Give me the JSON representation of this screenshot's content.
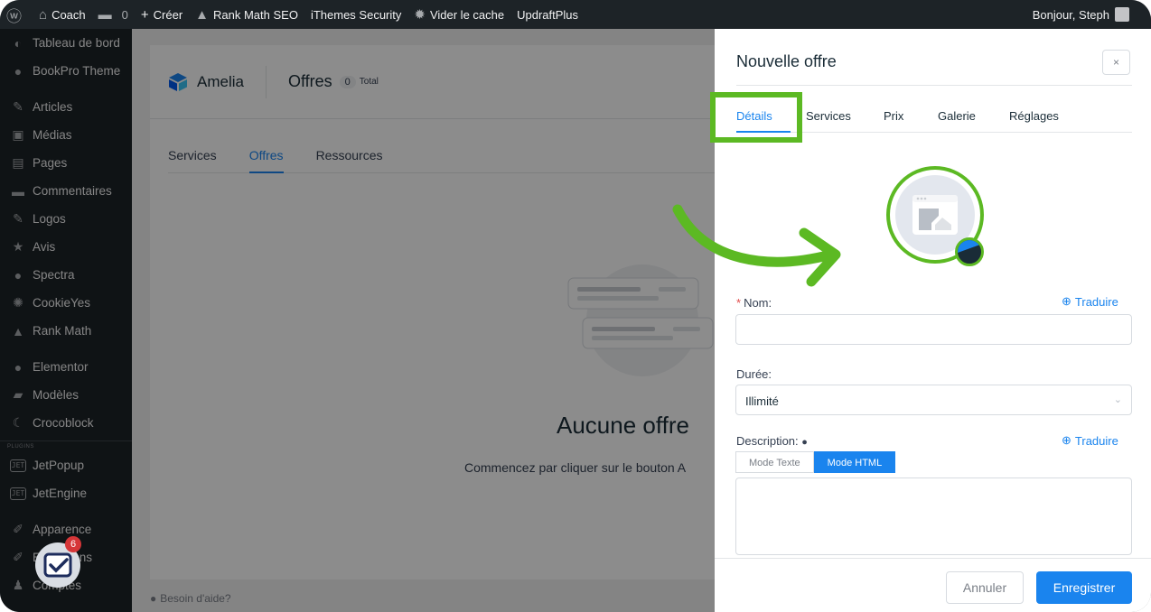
{
  "admin_bar": {
    "site_name": "Coach",
    "comments_count": "0",
    "create": "Créer",
    "rank_math": "Rank Math SEO",
    "security": "iThemes Security",
    "cache": "Vider le cache",
    "updraft": "UpdraftPlus",
    "greeting": "Bonjour, Steph"
  },
  "sidebar": {
    "items": [
      {
        "label": "Tableau de bord",
        "icon": "dashboard-icon",
        "glyph": "◐"
      },
      {
        "label": "BookPro Theme",
        "icon": "bookpro-icon",
        "glyph": "●"
      },
      {
        "label": "Articles",
        "icon": "pin-icon",
        "glyph": "✎"
      },
      {
        "label": "Médias",
        "icon": "media-icon",
        "glyph": "▣"
      },
      {
        "label": "Pages",
        "icon": "pages-icon",
        "glyph": "▤"
      },
      {
        "label": "Commentaires",
        "icon": "comment-icon",
        "glyph": "▬"
      },
      {
        "label": "Logos",
        "icon": "pin-icon",
        "glyph": "✎"
      },
      {
        "label": "Avis",
        "icon": "star-icon",
        "glyph": "★"
      },
      {
        "label": "Spectra",
        "icon": "spectra-icon",
        "glyph": "●"
      },
      {
        "label": "CookieYes",
        "icon": "cookie-icon",
        "glyph": "✺"
      },
      {
        "label": "Rank Math",
        "icon": "rankmath-icon",
        "glyph": "▲"
      },
      {
        "label": "Elementor",
        "icon": "elementor-icon",
        "glyph": "●"
      },
      {
        "label": "Modèles",
        "icon": "folder-icon",
        "glyph": "▰"
      },
      {
        "label": "Crocoblock",
        "icon": "crocoblock-icon",
        "glyph": "☾"
      },
      {
        "label": "JetPopup",
        "icon": "jet-icon",
        "glyph": "JET"
      },
      {
        "label": "JetEngine",
        "icon": "jet-icon",
        "glyph": "JET"
      },
      {
        "label": "Apparence",
        "icon": "brush-icon",
        "glyph": "✐"
      },
      {
        "label": "Extensions",
        "icon": "plugin-icon",
        "glyph": "✐"
      },
      {
        "label": "Comptes",
        "icon": "user-icon",
        "glyph": "♟"
      }
    ],
    "section_label": "PLUGINS"
  },
  "amelia": {
    "brand": "Amelia",
    "page_title": "Offres",
    "count": "0",
    "total_label": "Total",
    "tabs": [
      "Services",
      "Offres",
      "Ressources"
    ],
    "active_tab": "Offres",
    "empty_title": "Aucune offre",
    "empty_sub": "Commencez par cliquer sur le bouton A",
    "help": "Besoin d'aide?"
  },
  "drawer": {
    "title": "Nouvelle offre",
    "close": "×",
    "tabs": [
      "Détails",
      "Services",
      "Prix",
      "Galerie",
      "Réglages"
    ],
    "active_tab": "Détails",
    "name_label": "Nom:",
    "translate": "Traduire",
    "duration_label": "Durée:",
    "duration_value": "Illimité",
    "description_label": "Description:",
    "mode_text": "Mode Texte",
    "mode_html": "Mode HTML",
    "cancel": "Annuler",
    "save": "Enregistrer"
  },
  "notification_count": "6",
  "colors": {
    "accent": "#1a84ee",
    "highlight": "#5cb923",
    "wp_dark": "#1d2327"
  }
}
